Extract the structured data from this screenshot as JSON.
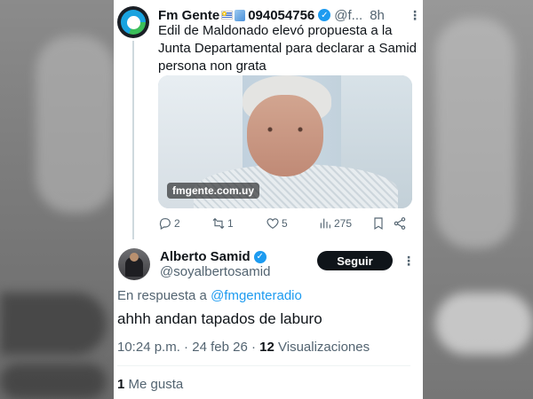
{
  "tweet": {
    "author_name": "Fm Gente",
    "author_phone": "094054756",
    "handle": "@f...",
    "time": "8h",
    "text": "Edil de Maldonado elevó propuesta a la Junta Departamental para declarar a Samid persona non grata",
    "media_watermark": "fmgente.com.uy",
    "replies": "2",
    "retweets": "1",
    "likes": "5",
    "views": "275"
  },
  "reply": {
    "author_name": "Alberto Samid",
    "handle": "@soyalbertosamid",
    "follow_label": "Seguir",
    "in_reply_prefix": "En respuesta a",
    "in_reply_handle": "@fmgenteradio",
    "text": "ahhh andan tapados de laburo",
    "time": "10:24 p.m.",
    "date": "24 feb 26",
    "views_count": "12",
    "views_label": "Visualizaciones",
    "likes_count": "1",
    "likes_label": "Me gusta"
  },
  "colors": {
    "verified": "#1d9bf0",
    "link": "#1d9bf0",
    "secondary_text": "#536471",
    "primary_text": "#0f1419"
  },
  "icons": [
    "reply-icon",
    "retweet-icon",
    "like-icon",
    "views-icon",
    "bookmark-icon",
    "share-icon",
    "more-icon",
    "verified-badge-icon"
  ]
}
